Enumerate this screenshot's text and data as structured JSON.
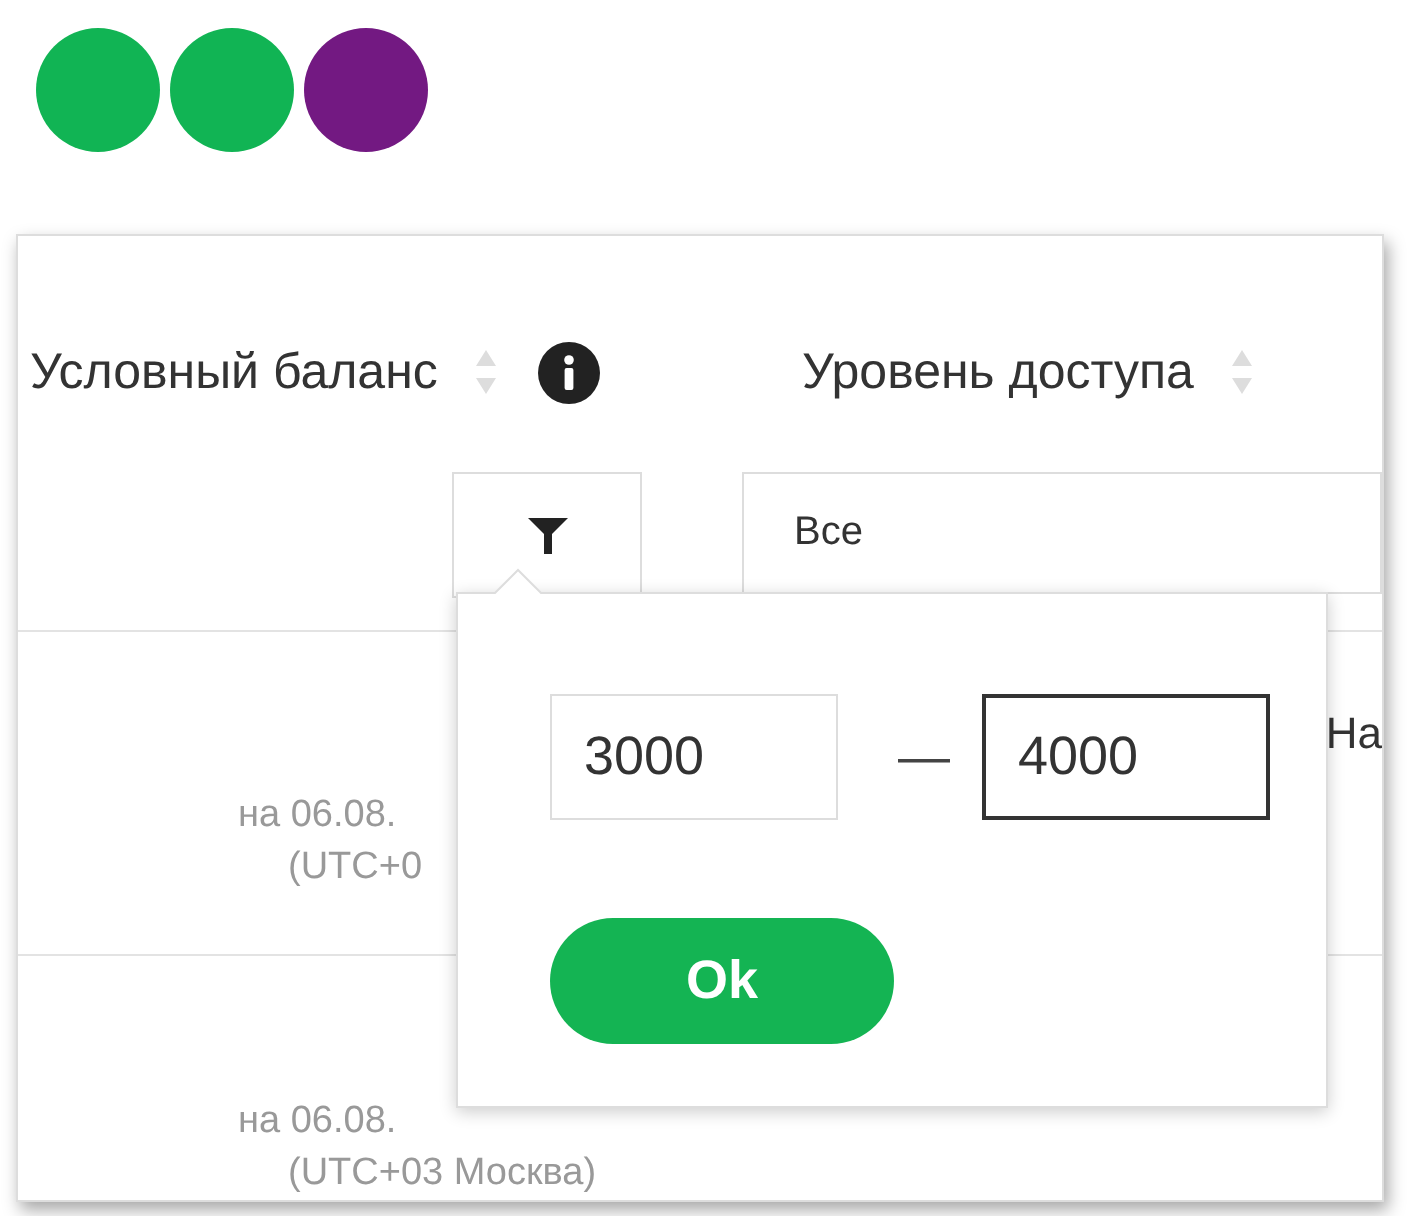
{
  "logo": {
    "dots": [
      {
        "color": "#11b454"
      },
      {
        "color": "#11b454"
      },
      {
        "color": "#731982"
      }
    ]
  },
  "columns": [
    {
      "label": "Условный баланс",
      "sortable": true,
      "info": true
    },
    {
      "label": "Уровень доступа",
      "sortable": true,
      "info": false
    }
  ],
  "filters": [
    {
      "kind": "button"
    },
    {
      "kind": "select",
      "value": "Все"
    }
  ],
  "popup": {
    "inputs": [
      {
        "value": "3000",
        "focused": false
      },
      {
        "value": "4000",
        "focused": true
      }
    ],
    "separator": "—",
    "button": "Ok"
  },
  "rows": [
    {
      "lines": [
        "на 06.08.",
        "(UTC+0"
      ],
      "extra": "На"
    },
    {
      "lines": [
        "на 06.08.",
        "(UTC+03 Москва)"
      ]
    }
  ]
}
